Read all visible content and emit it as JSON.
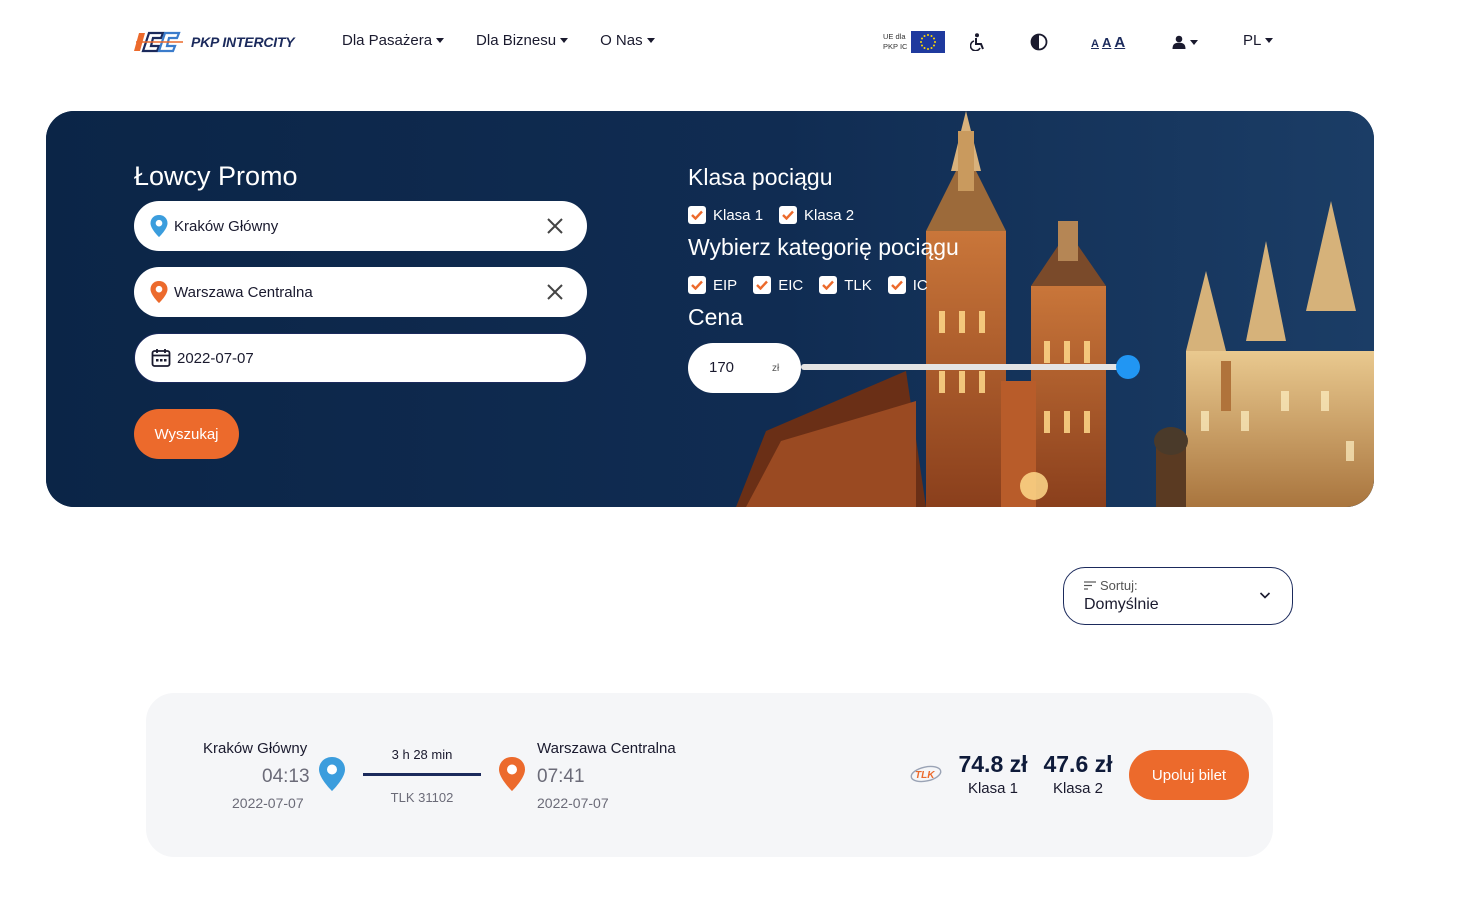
{
  "brand": {
    "name": "PKP INTERCITY"
  },
  "nav": {
    "items": [
      {
        "label": "Dla Pasażera"
      },
      {
        "label": "Dla Biznesu"
      },
      {
        "label": "O Nas"
      }
    ],
    "ue_label_1": "UE dla",
    "ue_label_2": "PKP IC",
    "font_sizes": [
      "A",
      "A",
      "A"
    ],
    "language": "PL"
  },
  "search": {
    "title": "Łowcy Promo",
    "from": "Kraków Główny",
    "to": "Warszawa Centralna",
    "date": "2022-07-07",
    "button": "Wyszukaj"
  },
  "filters": {
    "class_title": "Klasa pociągu",
    "classes": [
      {
        "label": "Klasa 1",
        "checked": true
      },
      {
        "label": "Klasa 2",
        "checked": true
      }
    ],
    "category_title": "Wybierz kategorię pociągu",
    "categories": [
      {
        "label": "EIP",
        "checked": true
      },
      {
        "label": "EIC",
        "checked": true
      },
      {
        "label": "TLK",
        "checked": true
      },
      {
        "label": "IC",
        "checked": true
      }
    ],
    "price_title": "Cena",
    "price_value": "170",
    "price_unit": "zł",
    "slider_level": 1.0
  },
  "sort": {
    "label": "Sortuj:",
    "value": "Domyślnie"
  },
  "results": [
    {
      "from": "Kraków Główny",
      "departure_time": "04:13",
      "departure_date": "2022-07-07",
      "duration": "3 h 28 min",
      "train": "TLK 31102",
      "to": "Warszawa Centralna",
      "arrival_time": "07:41",
      "arrival_date": "2022-07-07",
      "carrier": "TLK",
      "price_class1": "74.8 zł",
      "label_class1": "Klasa 1",
      "price_class2": "47.6 zł",
      "label_class2": "Klasa 2",
      "button": "Upoluj bilet"
    }
  ],
  "colors": {
    "accent_orange": "#ec6a2c",
    "navy": "#1b2a5c",
    "slider_blue": "#2196f3",
    "pin_blue": "#3b9ddd",
    "pin_orange": "#ec6a2c",
    "checkbox_orange": "#ec6a2c"
  }
}
